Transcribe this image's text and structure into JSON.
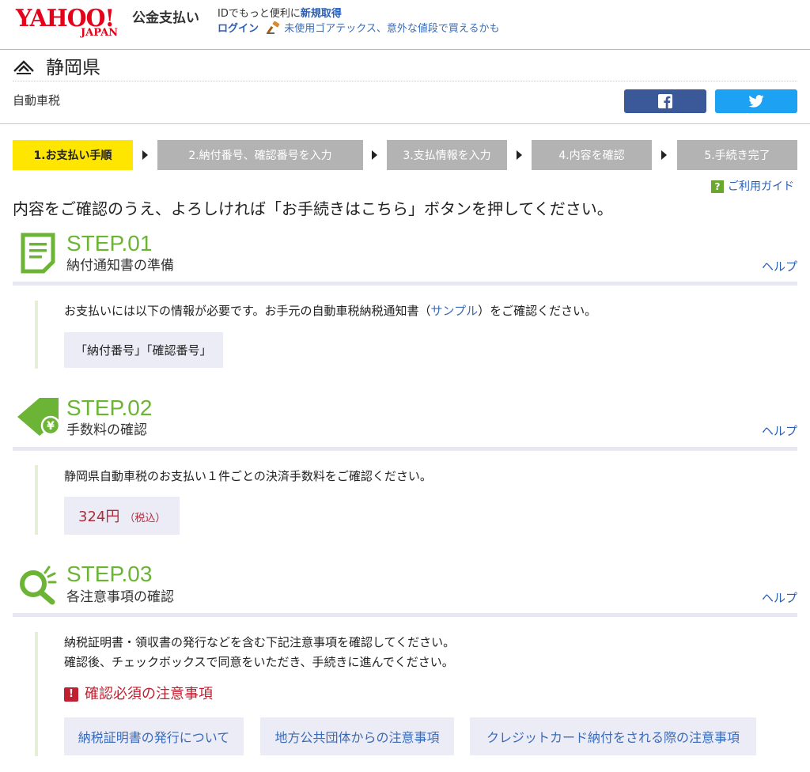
{
  "header": {
    "logo_main": "YAHOO!",
    "logo_sub": "JAPAN",
    "service": "公金支払い",
    "line1_prefix": "IDでもっと便利に",
    "signup": "新規取得",
    "login": "ログイン",
    "promo": "未使用ゴアテックス、意外な値段で買えるかも"
  },
  "title": {
    "prefecture": "静岡県",
    "tax_type": "自動車税"
  },
  "share": {
    "facebook_icon": "facebook-icon",
    "twitter_icon": "twitter-icon",
    "facebook_color": "#3b5998",
    "twitter_color": "#1da1f2"
  },
  "progress": {
    "steps": [
      "1.お支払い手順",
      "2.納付番号、確認番号を入力",
      "3.支払情報を入力",
      "4.内容を確認",
      "5.手続き完了"
    ],
    "active_index": 0
  },
  "guide": {
    "icon": "?",
    "label": "ご利用ガイド"
  },
  "lead": "内容をご確認のうえ、よろしければ「お手続きはこちら」ボタンを押してください。",
  "steps": [
    {
      "num": "STEP.01",
      "title": "納付通知書の準備",
      "help": "ヘルプ",
      "text_before": "お支払いには以下の情報が必要です。お手元の自動車税納税通知書（",
      "sample_link": "サンプル",
      "text_after": "）をご確認ください。",
      "box": "「納付番号」「確認番号」"
    },
    {
      "num": "STEP.02",
      "title": "手数料の確認",
      "help": "ヘルプ",
      "text": "静岡県自動車税のお支払い１件ごとの決済手数料をご確認ください。",
      "fee": "324円",
      "fee_note": "（税込）"
    },
    {
      "num": "STEP.03",
      "title": "各注意事項の確認",
      "help": "ヘルプ",
      "text1": "納税証明書・領収書の発行などを含む下記注意事項を確認してください。",
      "text2": "確認後、チェックボックスで同意をいただき、手続きに進んでください。",
      "warning_icon": "!",
      "warning": "確認必須の注意事項",
      "notices": [
        "納税証明書の発行について",
        "地方公共団体からの注意事項",
        "クレジットカード納付をされる際の注意事項"
      ]
    }
  ],
  "colors": {
    "accent_green": "#6cb436",
    "active_step": "#ffe600",
    "link_blue": "#2a5eb5",
    "warning_red": "#c0202f"
  }
}
